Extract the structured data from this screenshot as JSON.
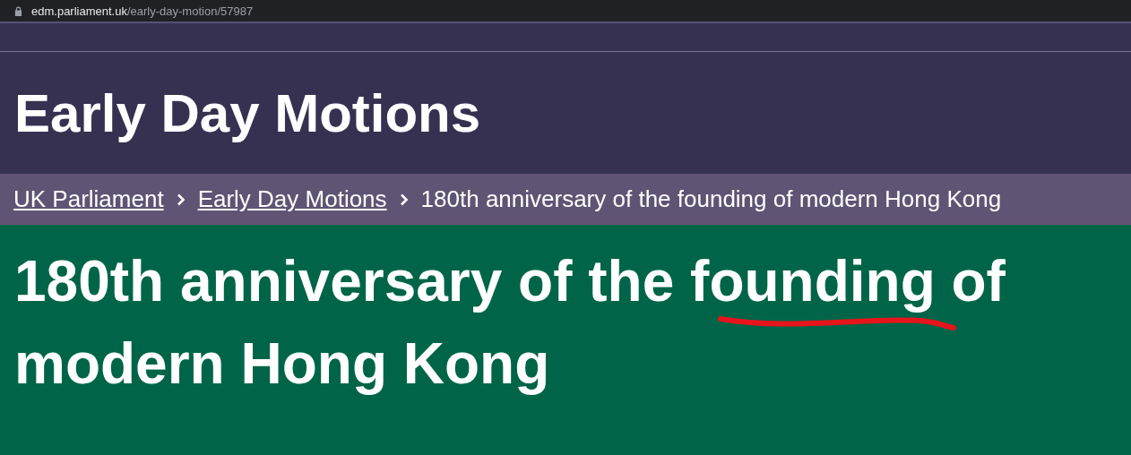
{
  "address_bar": {
    "host": "edm.parliament.uk",
    "path": "/early-day-motion/57987"
  },
  "header": {
    "title": "Early Day Motions"
  },
  "breadcrumb": [
    {
      "label": "UK Parliament",
      "kind": "link"
    },
    {
      "label": "Early Day Motions",
      "kind": "link"
    },
    {
      "label": "180th anniversary of the founding of modern Hong Kong",
      "kind": "current"
    }
  ],
  "motion": {
    "title_lines": [
      "180th anniversary of the founding of",
      "modern Hong Kong"
    ]
  }
}
